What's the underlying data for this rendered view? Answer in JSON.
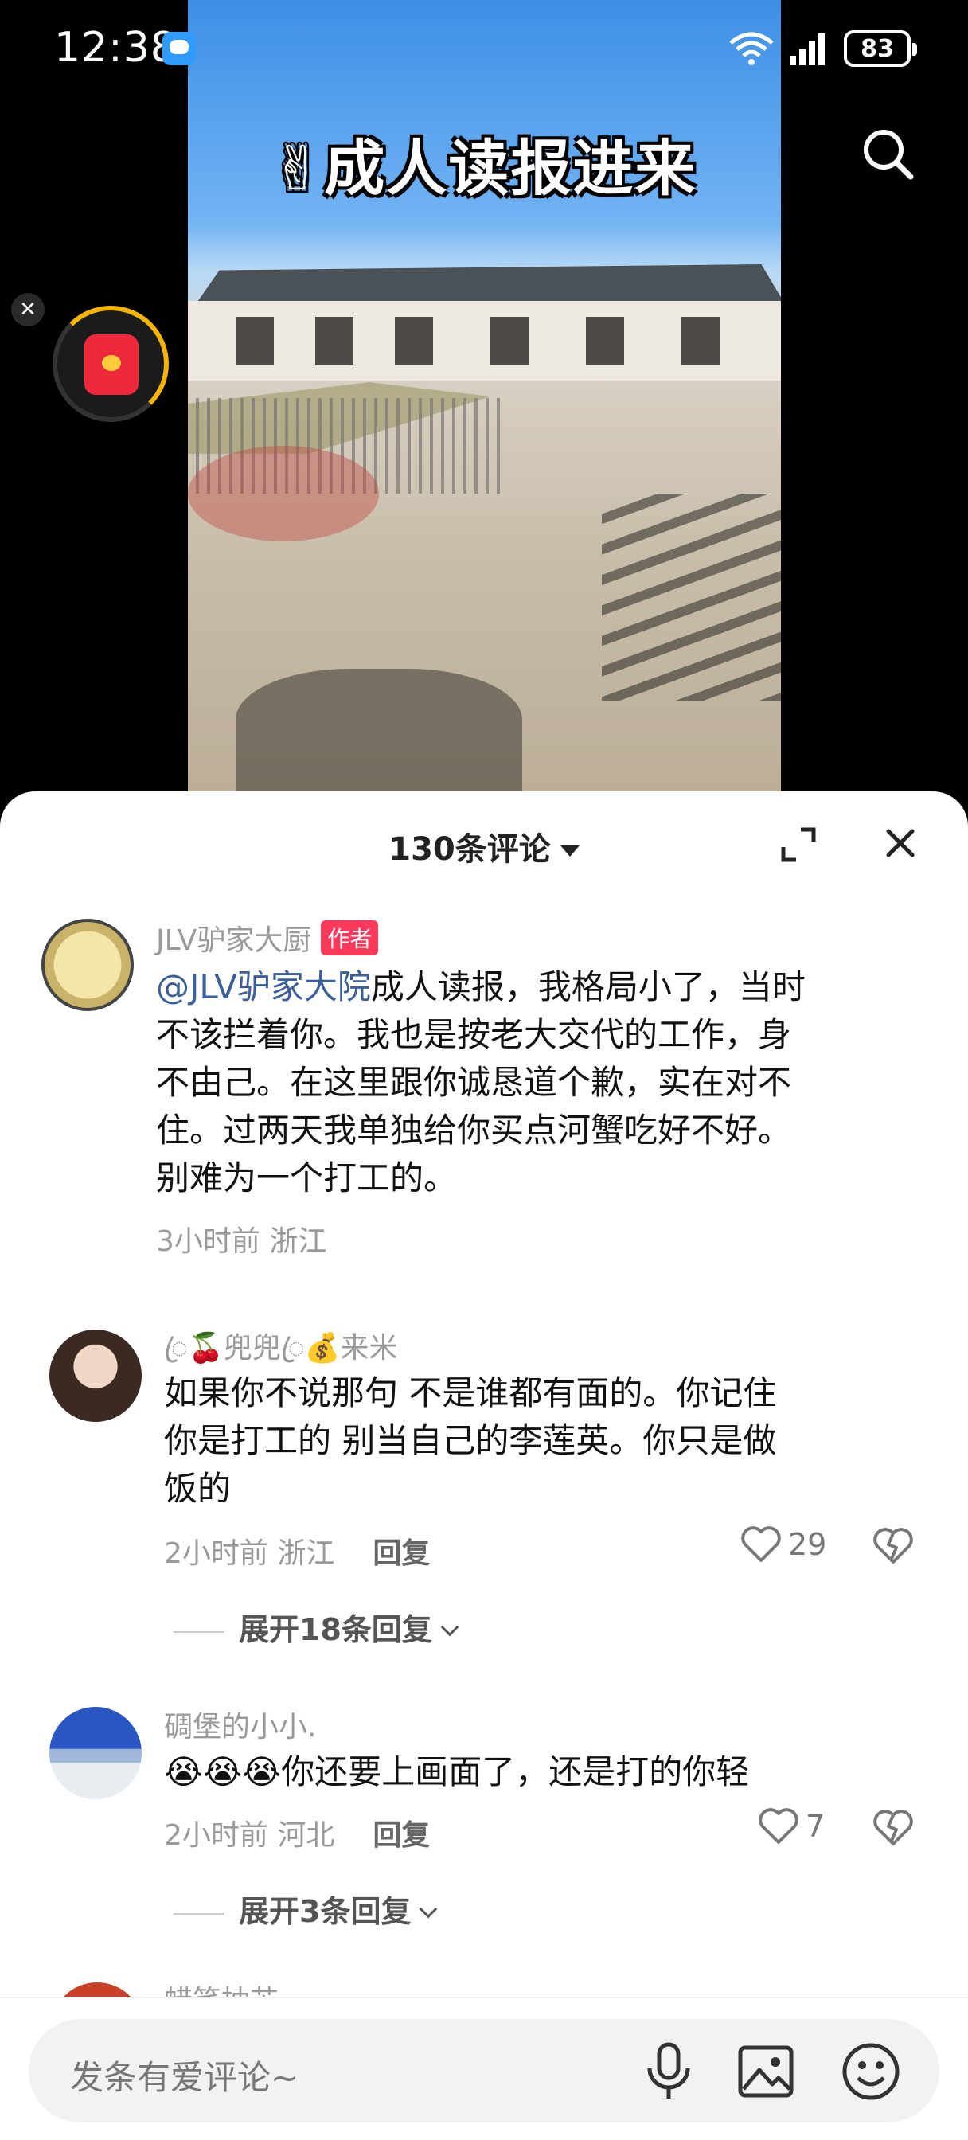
{
  "status_bar": {
    "time": "12:38",
    "battery": "83"
  },
  "video": {
    "title": "✌成人读报进来"
  },
  "sheet": {
    "comment_count": "130条评论"
  },
  "comments": [
    {
      "username": "JLV驴家大厨",
      "badge": "作者",
      "mention": "@JLV驴家大院",
      "text_lines": [
        "成人读报，我格局小了，当时",
        "不该拦着你。我也是按老大交代的工作，身",
        "不由己。在这里跟你诚恳道个歉，实在对不",
        "住。过两天我单独给你买点河蟹吃好不好。",
        "别难为一个打工的。"
      ],
      "meta": "3小时前 浙江"
    },
    {
      "username": "ꦿ🍒兜兜ꦿ💰来米",
      "text_lines": [
        "如果你不说那句 不是谁都有面的。你记住",
        "你是打工的  别当自己的李莲英。你只是做",
        "饭的"
      ],
      "meta": "2小时前 浙江",
      "reply": "回复",
      "likes": "29",
      "expand": "展开18条回复"
    },
    {
      "username": "碉堡的小小.",
      "text_lines": [
        "😭😭😭你还要上画面了，还是打的你轻"
      ],
      "meta": "2小时前 河北",
      "reply": "回复",
      "likes": "7",
      "expand": "展开3条回复"
    }
  ],
  "partial_username": "蜡笔抽芯",
  "input": {
    "placeholder": "发条有爱评论~"
  },
  "colors": {
    "accent_pink": "#fd3a5c",
    "mention_blue": "#3d5f99",
    "meta_gray": "#9a9a9a"
  }
}
